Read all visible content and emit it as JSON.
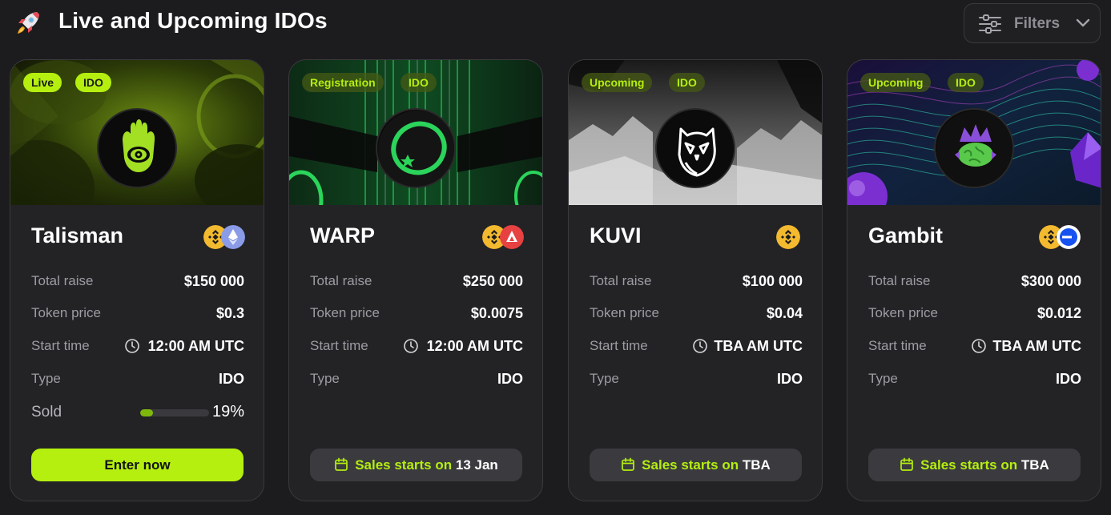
{
  "header": {
    "title": "Live and Upcoming IDOs",
    "rocket_icon": "rocket-icon",
    "filters_label": "Filters"
  },
  "colors": {
    "accent": "#b4ef0f",
    "card_bg": "#232326",
    "page_bg": "#1c1c1e",
    "muted": "#9c9ca2"
  },
  "labels": {
    "total_raise": "Total raise",
    "token_price": "Token price",
    "start_time": "Start time",
    "type": "Type",
    "sold": "Sold"
  },
  "cards": [
    {
      "name": "Talisman",
      "status_tag": "Live",
      "type_tag": "IDO",
      "chains": [
        "bnb-icon",
        "ethereum-icon"
      ],
      "total_raise": "$150 000",
      "token_price": "$0.3",
      "start_time": "12:00 AM UTC",
      "type": "IDO",
      "sold_percent": "19%",
      "sold_fraction": 0.19,
      "cta": "Enter now"
    },
    {
      "name": "WARP",
      "status_tag": "Registration",
      "type_tag": "IDO",
      "chains": [
        "bnb-icon",
        "avalanche-icon"
      ],
      "total_raise": "$250 000",
      "token_price": "$0.0075",
      "start_time": "12:00 AM UTC",
      "type": "IDO",
      "cta_prefix": "Sales starts on",
      "cta_date": "13 Jan"
    },
    {
      "name": "KUVI",
      "status_tag": "Upcoming",
      "type_tag": "IDO",
      "chains": [
        "bnb-icon"
      ],
      "total_raise": "$100 000",
      "token_price": "$0.04",
      "start_time": "TBA AM UTC",
      "type": "IDO",
      "cta_prefix": "Sales starts on",
      "cta_date": "TBA"
    },
    {
      "name": "Gambit",
      "status_tag": "Upcoming",
      "type_tag": "IDO",
      "chains": [
        "bnb-icon",
        "base-icon"
      ],
      "total_raise": "$300 000",
      "token_price": "$0.012",
      "start_time": "TBA AM UTC",
      "type": "IDO",
      "cta_prefix": "Sales starts on",
      "cta_date": "TBA"
    }
  ]
}
